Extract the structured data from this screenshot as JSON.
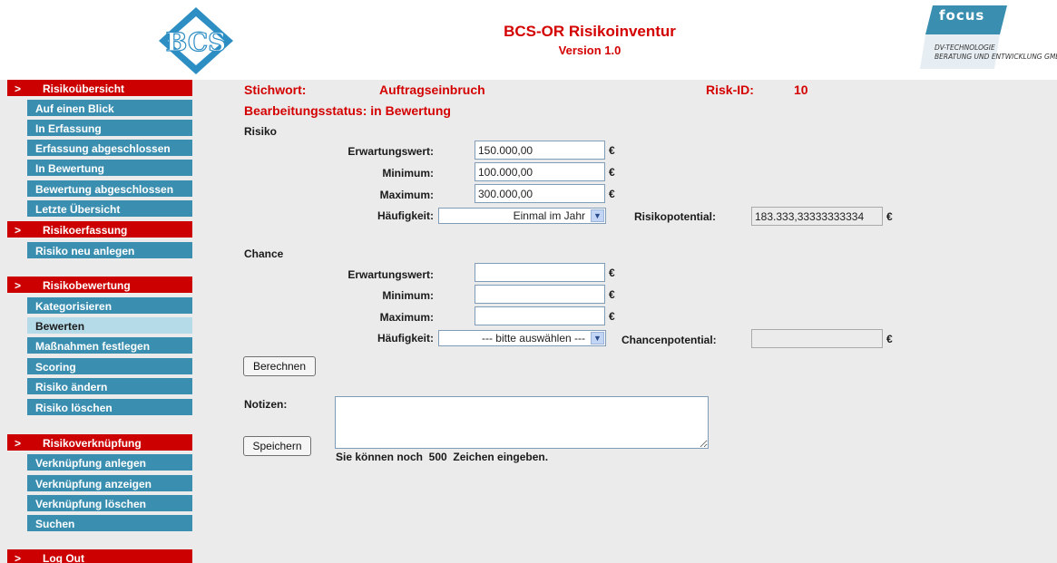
{
  "header": {
    "title": "BCS-OR Risikoinventur",
    "version": "Version 1.0",
    "bcs_logo_text": "BCS",
    "focus_logo": {
      "word": "focus",
      "line1": "DV-TECHNOLOGIE",
      "line2": "BERATUNG UND ENTWICKLUNG GMBH"
    }
  },
  "sidebar": {
    "arrow": ">",
    "groups": [
      {
        "label": "Risikoübersicht",
        "items": [
          "Auf einen Blick",
          "In Erfassung",
          "Erfassung abgeschlossen",
          "In Bewertung",
          "Bewertung abgeschlossen",
          "Letzte Übersicht"
        ]
      },
      {
        "label": "Risikoerfassung",
        "items": [
          "Risiko neu anlegen"
        ]
      },
      {
        "label": "Risikobewertung",
        "items": [
          "Kategorisieren",
          "Bewerten",
          "Maßnahmen festlegen",
          "Scoring",
          "Risiko ändern",
          "Risiko löschen"
        ]
      },
      {
        "label": "Risikoverknüpfung",
        "items": [
          "Verknüpfung anlegen",
          "Verknüpfung anzeigen",
          "Verknüpfung löschen",
          "Suchen"
        ]
      },
      {
        "label": "Log Out",
        "items": []
      }
    ],
    "active_item": "Bewerten"
  },
  "form": {
    "stichwort_label": "Stichwort:",
    "stichwort_value": "Auftragseinbruch",
    "risk_id_label": "Risk-ID:",
    "risk_id_value": "10",
    "status": "Bearbeitungsstatus: in Bewertung",
    "currency": "€",
    "risiko": {
      "heading": "Risiko",
      "erwartungswert_label": "Erwartungswert:",
      "erwartungswert_value": "150.000,00",
      "minimum_label": "Minimum:",
      "minimum_value": "100.000,00",
      "maximum_label": "Maximum:",
      "maximum_value": "300.000,00",
      "haeufigkeit_label": "Häufigkeit:",
      "haeufigkeit_value": "Einmal im Jahr",
      "potential_label": "Risikopotential:",
      "potential_value": "183.333,33333333334"
    },
    "chance": {
      "heading": "Chance",
      "erwartungswert_label": "Erwartungswert:",
      "erwartungswert_value": "",
      "minimum_label": "Minimum:",
      "minimum_value": "",
      "maximum_label": "Maximum:",
      "maximum_value": "",
      "haeufigkeit_label": "Häufigkeit:",
      "haeufigkeit_value": "--- bitte auswählen ---",
      "potential_label": "Chancenpotential:",
      "potential_value": ""
    },
    "berechnen_button": "Berechnen",
    "notizen_label": "Notizen:",
    "notizen_value": "",
    "speichern_button": "Speichern",
    "chars_remaining_text": "Sie können noch  500  Zeichen eingeben."
  },
  "colors": {
    "brand_red": "#cc0000",
    "nav_blue": "#3a8eb0",
    "nav_active": "#b6dbe8",
    "content_bg": "#ebebeb"
  }
}
